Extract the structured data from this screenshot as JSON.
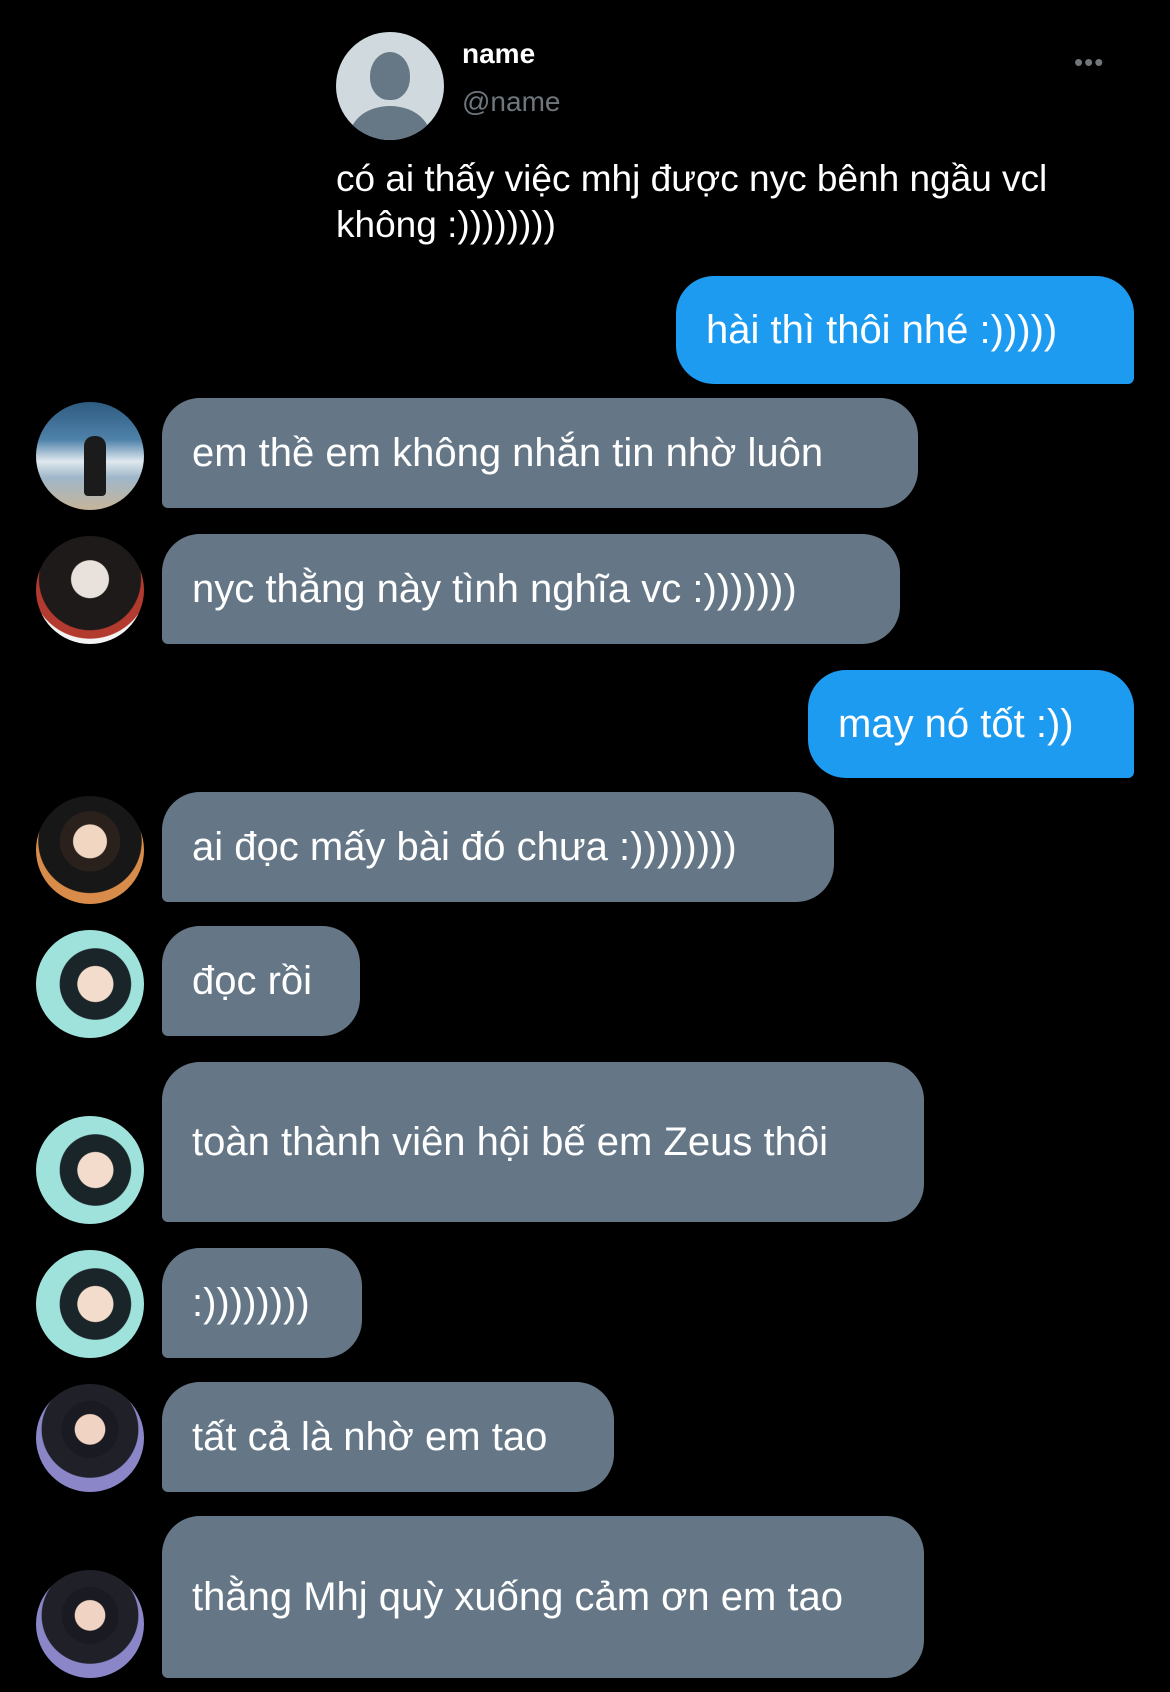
{
  "tweet": {
    "display_name": "name",
    "handle": "@name",
    "text": "có ai thấy việc mhj được nyc bênh ngầu vcl không :))))))))",
    "more_icon": "more-horizontal-icon",
    "avatar_icon": "default-profile-icon"
  },
  "colors": {
    "background": "#000000",
    "sent_bubble": "#1d9bf0",
    "received_bubble": "#657786",
    "handle_text": "#6e767d"
  },
  "messages": [
    {
      "direction": "sent",
      "text": "hài thì thôi nhé :)))))"
    },
    {
      "direction": "received",
      "text": "em thề em không nhắn tin nhờ luôn",
      "avatar": "beach-photo-avatar"
    },
    {
      "direction": "received",
      "text": "nyc thằng này tình nghĩa vc :)))))))",
      "avatar": "dark-jacket-avatar"
    },
    {
      "direction": "sent",
      "text": "may nó tốt :))"
    },
    {
      "direction": "received",
      "text": "ai đọc mấy bài đó chưa :))))))))",
      "avatar": "jersey-avatar"
    },
    {
      "direction": "received",
      "text": "đọc rồi",
      "avatar": "teal-background-avatar"
    },
    {
      "direction": "received",
      "text": "toàn thành viên hội bế em Zeus thôi",
      "avatar": "teal-background-avatar"
    },
    {
      "direction": "received",
      "text": ":))))))))",
      "avatar": "teal-background-avatar"
    },
    {
      "direction": "received",
      "text": "tất cả là nhờ em tao",
      "avatar": "purple-background-avatar"
    },
    {
      "direction": "received",
      "text": "thằng Mhj quỳ xuống cảm ơn em tao",
      "avatar": "purple-background-avatar"
    }
  ]
}
